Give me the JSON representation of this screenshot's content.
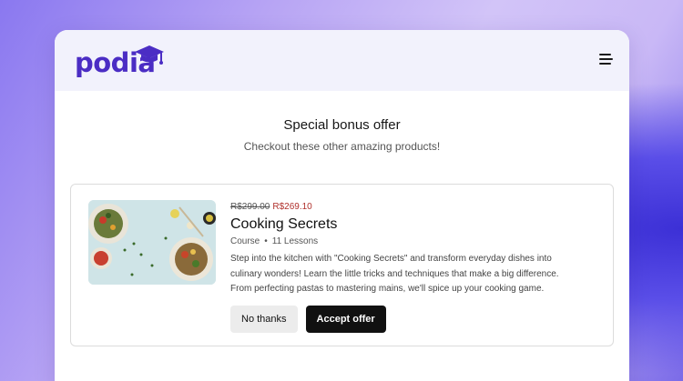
{
  "brand": {
    "logo_text": "podia",
    "logo_icon": "graduation-cap-icon",
    "color": "#4b2dc4"
  },
  "header": {
    "menu_icon": "hamburger-menu-icon"
  },
  "offer": {
    "heading": "Special bonus offer",
    "subheading": "Checkout these other amazing products!"
  },
  "product": {
    "image": "food-dishes-photo",
    "old_price": "R$299.00",
    "new_price": "R$269.10",
    "title": "Cooking Secrets",
    "type": "Course",
    "separator": "•",
    "lessons": "11 Lessons",
    "description": "Step into the kitchen with \"Cooking Secrets\" and transform everyday dishes into culinary wonders! Learn the little tricks and techniques that make a big difference. From perfecting pastas to mastering mains, we'll spice up your cooking game.",
    "decline_label": "No thanks",
    "accept_label": "Accept offer"
  },
  "colors": {
    "sale_price": "#b0302c",
    "accept_button": "#111111",
    "decline_button": "#ececec"
  }
}
